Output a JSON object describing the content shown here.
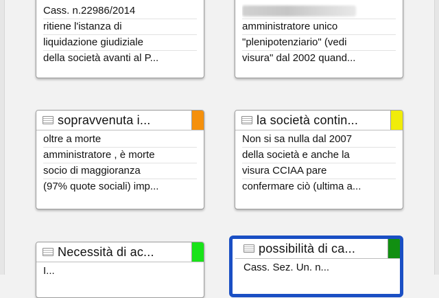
{
  "cards": [
    {
      "title": "",
      "lines": [
        "Cass. n.22986/2014",
        "ritiene l'istanza di",
        "liquidazione giudiziale",
        "della società avanti al P..."
      ]
    },
    {
      "title": "",
      "lines": [
        "",
        "amministratore unico",
        "\"plenipotenziario\" (vedi",
        "visura\" dal 2002 quand..."
      ]
    },
    {
      "title": "sopravvenuta i...",
      "tab_color": "#f5900c",
      "lines": [
        "oltre a morte",
        "amministratore , è morte",
        "socio di maggioranza",
        "(97% quote sociali) imp..."
      ]
    },
    {
      "title": "la società contin...",
      "tab_color": "#f0ec0a",
      "lines": [
        "Non si sa nulla dal 2007",
        "della società e anche la",
        "visura CCIAA pare",
        "confermare ciò (ultima a..."
      ]
    },
    {
      "title": "Necessità di ac...",
      "tab_color": "#19e319",
      "lines": [
        "I..."
      ]
    },
    {
      "title": "possibilità di ca...",
      "tab_color": "#118f11",
      "selected": true,
      "lines": [
        "Cass. Sez. Un. n..."
      ]
    }
  ]
}
